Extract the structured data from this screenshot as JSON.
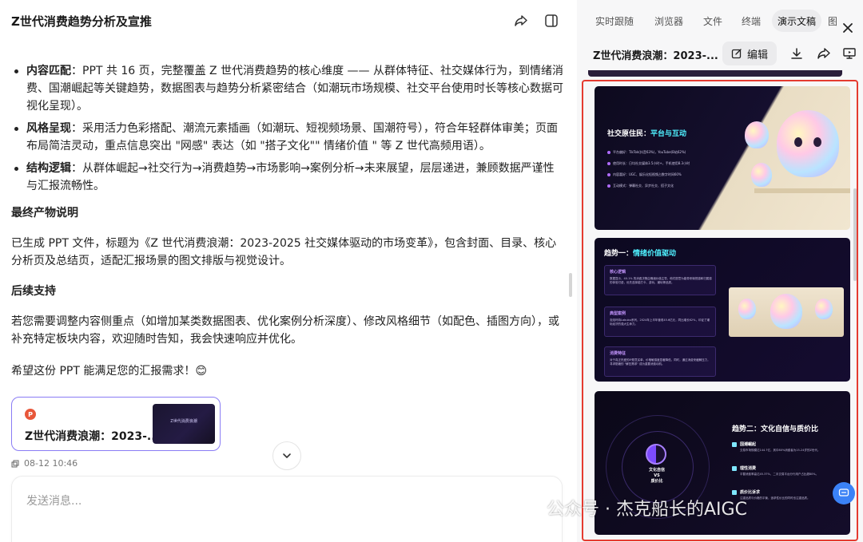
{
  "left": {
    "title": "Z世代消费趋势分析及宣推",
    "bullets": [
      {
        "label": "内容匹配",
        "text": "：PPT 共 16 页，完整覆盖 Z 世代消费趋势的核心维度 —— 从群体特征、社交媒体行为，到情绪消费、国潮崛起等关键趋势，数据图表与趋势分析紧密结合（如潮玩市场规模、社交平台使用时长等核心数据可视化呈现）。"
      },
      {
        "label": "风格呈现",
        "text": "：采用活力色彩搭配、潮流元素插画（如潮玩、短视频场景、国潮符号），符合年轻群体审美；页面布局简洁灵动，重点信息突出 \"网感\" 表达（如 \"搭子文化\"\" 情绪价值 \" 等 Z 世代高频用语）。"
      },
      {
        "label": "结构逻辑",
        "text": "：从群体崛起→社交行为→消费趋势→市场影响→案例分析→未来展望，层层递进，兼顾数据严谨性与汇报流畅性。"
      }
    ],
    "section1_title": "最终产物说明",
    "section1_text": "已生成 PPT 文件，标题为《Z 世代消费浪潮：2023-2025 社交媒体驱动的市场变革》，包含封面、目录、核心分析页及总结页，适配汇报场景的图文排版与视觉设计。",
    "section2_title": "后续支持",
    "section2_text": "若您需要调整内容侧重点（如增加某类数据图表、优化案例分析深度）、修改风格细节（如配色、插图方向），或补充特定板块内容，欢迎随时告知，我会快速响应并优化。",
    "closing": "希望这份 PPT 能满足您的汇报需求！😊",
    "file_card": {
      "icon_letter": "P",
      "name": "Z世代消费浪潮：2023-...",
      "thumb_text": "Z世代消费浪潮"
    },
    "timestamp": "08-12 10:46",
    "input_placeholder": "发送消息..."
  },
  "right": {
    "tabs": [
      "实时跟随",
      "浏览器",
      "文件",
      "终端",
      "演示文稿",
      "图"
    ],
    "active_tab": "演示文稿",
    "doc_title": "Z世代消费浪潮：2023-...",
    "edit_label": "编辑",
    "slide1": {
      "title_prefix": "社交原住民：",
      "title_highlight": "平台与互动",
      "lines": [
        "平台偏好：TikTok(抖音63%)，YouTube(B站62%)",
        "使用时长：日均社交媒体3.5小时+，手机使用8.3小时",
        "内容喜好：UGC、娱乐化短视频占数字时间60%",
        "互动模式：弹幕社交、异步社交、搭子文化"
      ]
    },
    "slide2": {
      "title_prefix": "趋势一：",
      "title_highlight": "情绪价值驱动",
      "boxes": [
        {
          "heading": "核心逻辑",
          "text": "数据显示，40.1% 的消费决策由情绪价值主导，他们愿意为能带来愉悦感和归属感的体验付费，优先选择能打卡、游玩、潮玩等品类。"
        },
        {
          "heading": "典型案例",
          "text": "泡泡玛特Labubu系列，2024年上半年营收45.6亿元，同比增长62%，印证了潮玩经济的强大生命力。"
        },
        {
          "heading": "消费特征",
          "text": "对于真正热爱的IP愿意买单，价格敏感度显著降低。同时，通过消费来缓解压力，寻求慰藉的 \"解压需求\" 成为重要消费动机。"
        }
      ]
    },
    "slide3": {
      "title": "趋势二：文化自信与质价比",
      "center_text": "文化自信\nVS\n质价比",
      "features": [
        {
          "heading": "国潮崛起",
          "text": "交易市场规模达144.7亿，其中80%消费者为15-24岁的Z世代。"
        },
        {
          "heading": "理性消费",
          "text": "平替消费率高达45.37%，二手交易平台分行用户占比超80%。"
        },
        {
          "heading": "质价比诉求",
          "text": "注重品质与价格的平衡，追求性价比的同时也注重品质。"
        }
      ]
    }
  },
  "watermark": "公众号 · 杰克船长的AIGC"
}
